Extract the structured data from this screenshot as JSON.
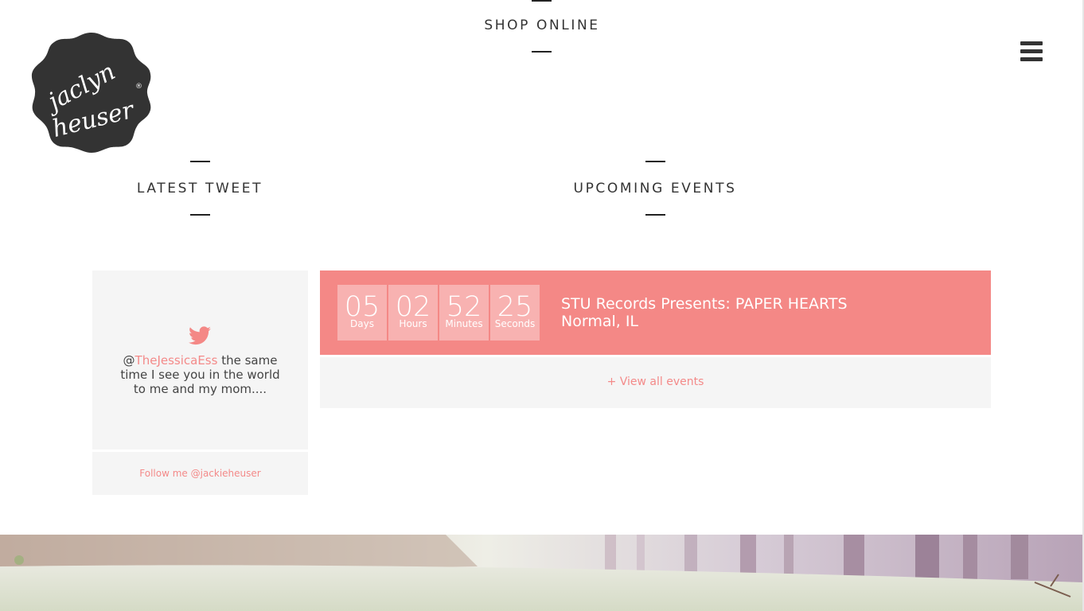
{
  "header": {
    "shop_label": "SHOP ONLINE",
    "logo_text_line1": "jaclyn",
    "logo_text_line2": "heuser",
    "menu_icon": "hamburger-icon"
  },
  "tweet_section": {
    "heading": "LATEST TWEET",
    "icon": "twitter-bird-icon",
    "mention": "TheJessicaEss",
    "at": "@",
    "text": " the same time I see you in the world to me and my mom....",
    "follow_label": "Follow me @jackieheuser"
  },
  "events_section": {
    "heading": "UPCOMING EVENTS",
    "countdown": [
      {
        "value": "05",
        "label": "Days"
      },
      {
        "value": "02",
        "label": "Hours"
      },
      {
        "value": "52",
        "label": "Minutes"
      },
      {
        "value": "25",
        "label": "Seconds"
      }
    ],
    "event_title": "STU Records Presents: PAPER HEARTS",
    "event_location": "Normal, IL",
    "view_all_label": "+ View all events"
  },
  "colors": {
    "accent": "#f48886",
    "accent_light": "#f8b2b1",
    "link": "#f48a89",
    "panel": "#f5f5f5",
    "logo": "#333333"
  }
}
